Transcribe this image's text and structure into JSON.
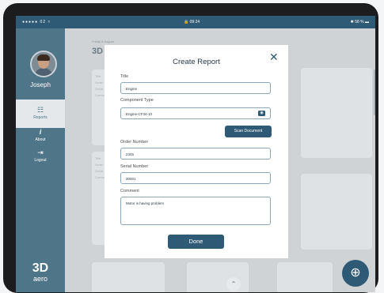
{
  "status_bar": {
    "carrier": "●●●●● 02  ≈",
    "time": "🔒 09:24",
    "battery": "✱ 58 % ▬"
  },
  "sidebar": {
    "user_name": "Joseph",
    "items": [
      {
        "label": "Reports",
        "icon": "reports-icon",
        "glyph": "☷",
        "active": true
      },
      {
        "label": "About",
        "icon": "info-icon",
        "glyph": "i",
        "active": false
      },
      {
        "label": "Logout",
        "icon": "logout-icon",
        "glyph": "⇥",
        "active": false
      }
    ],
    "logo": {
      "line1": "3D",
      "line2": "aero"
    }
  },
  "background": {
    "date": "Friday 8 August",
    "title": "3D",
    "card_lines": [
      "Title",
      "Order",
      "Serial",
      "Comm"
    ]
  },
  "modal": {
    "title": "Create Report",
    "close_glyph": "✕",
    "fields": {
      "title": {
        "label": "Title",
        "value": "Engine"
      },
      "component_type": {
        "label": "Component Type",
        "value": "Engine-CF34-10"
      },
      "order_number": {
        "label": "Order Number",
        "value": "2345"
      },
      "serial_number": {
        "label": "Serial Number",
        "value": "30001"
      },
      "comment": {
        "label": "Comment",
        "value": "Motor is having problem"
      }
    },
    "scan_button": "Scan Document",
    "done_button": "Done"
  },
  "fab_glyph": "⊕",
  "scroll_up_glyph": "⌃",
  "colors": {
    "primary": "#2e5a75",
    "sidebar": "#4f7588",
    "overlay": "#cfd3d6"
  }
}
